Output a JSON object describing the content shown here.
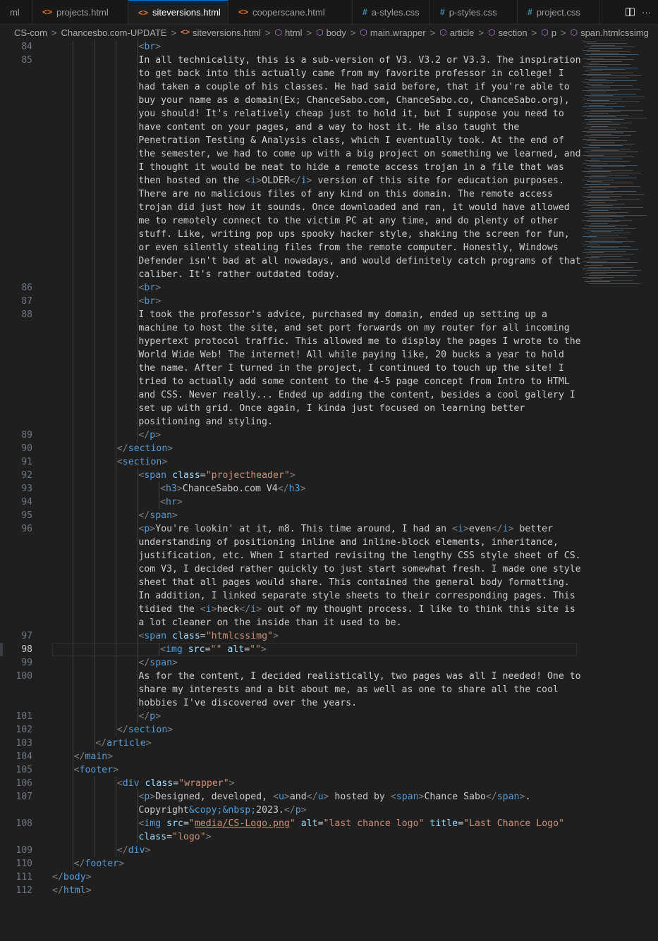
{
  "tabs": [
    {
      "label": "ml",
      "type": "none",
      "active": false
    },
    {
      "label": "projects.html",
      "type": "html",
      "active": false
    },
    {
      "label": "siteversions.html",
      "type": "html",
      "active": true,
      "modified": true
    },
    {
      "label": "cooperscane.html",
      "type": "html",
      "active": false
    },
    {
      "label": "a-styles.css",
      "type": "css",
      "active": false
    },
    {
      "label": "p-styles.css",
      "type": "css",
      "active": false
    },
    {
      "label": "project.css",
      "type": "css",
      "active": false
    }
  ],
  "icons": {
    "html_glyph": "<>",
    "css_glyph": "#",
    "more": "···",
    "sep": ">"
  },
  "breadcrumb": [
    {
      "label": "CS-com",
      "icon": ""
    },
    {
      "label": "Chancesbo.com-UPDATE",
      "icon": ""
    },
    {
      "label": "siteversions.html",
      "icon": "html"
    },
    {
      "label": "html",
      "icon": "cube"
    },
    {
      "label": "body",
      "icon": "cube"
    },
    {
      "label": "main.wrapper",
      "icon": "cube"
    },
    {
      "label": "article",
      "icon": "cube"
    },
    {
      "label": "section",
      "icon": "cube"
    },
    {
      "label": "p",
      "icon": "cube"
    },
    {
      "label": "span.htmlcssimg",
      "icon": "cube"
    }
  ],
  "current_line": 98,
  "colors": {
    "tag": "#569cd6",
    "attr": "#9cdcfe",
    "value": "#ce9178",
    "bracket": "#808080",
    "text": "#cccccc"
  },
  "lines": [
    {
      "n": "84",
      "i": 4,
      "tokens": [
        [
          "tg",
          "<"
        ],
        [
          "tn",
          "br"
        ],
        [
          "tg",
          ">"
        ]
      ]
    },
    {
      "n": "85",
      "i": 4,
      "tokens": [
        [
          "tx",
          "In all technicality, this is a sub-version of V3. V3.2 or V3.3. The inspiration"
        ]
      ]
    },
    {
      "n": "",
      "i": 4,
      "tokens": [
        [
          "tx",
          "to get back into this actually came from my favorite professor in college! I"
        ]
      ]
    },
    {
      "n": "",
      "i": 4,
      "tokens": [
        [
          "tx",
          "had taken a couple of his classes. He had said before, that if you're able to"
        ]
      ]
    },
    {
      "n": "",
      "i": 4,
      "tokens": [
        [
          "tx",
          "buy your name as a domain(Ex; ChanceSabo.com, ChanceSabo.co, ChanceSabo.org),"
        ]
      ]
    },
    {
      "n": "",
      "i": 4,
      "tokens": [
        [
          "tx",
          "you should! It's relatively cheap just to hold it, but I suppose you need to"
        ]
      ]
    },
    {
      "n": "",
      "i": 4,
      "tokens": [
        [
          "tx",
          "have content on your pages, and a way to host it. He also taught the"
        ]
      ]
    },
    {
      "n": "",
      "i": 4,
      "tokens": [
        [
          "tx",
          "Penetration Testing & Analysis class, which I eventually took. At the end of"
        ]
      ]
    },
    {
      "n": "",
      "i": 4,
      "tokens": [
        [
          "tx",
          "the semester, we had to come up with a big project on something we learned, and"
        ]
      ]
    },
    {
      "n": "",
      "i": 4,
      "tokens": [
        [
          "tx",
          "I thought it would be neat to hide a remote access trojan in a file that was"
        ]
      ]
    },
    {
      "n": "",
      "i": 4,
      "tokens": [
        [
          "tx",
          "then hosted on the "
        ],
        [
          "tg",
          "<"
        ],
        [
          "tn",
          "i"
        ],
        [
          "tg",
          ">"
        ],
        [
          "tx",
          "OLDER"
        ],
        [
          "tg",
          "</"
        ],
        [
          "tn",
          "i"
        ],
        [
          "tg",
          ">"
        ],
        [
          "tx",
          " version of this site for education purposes."
        ]
      ]
    },
    {
      "n": "",
      "i": 4,
      "tokens": [
        [
          "tx",
          "There are no malicious files of any kind on this domain. The remote access"
        ]
      ]
    },
    {
      "n": "",
      "i": 4,
      "tokens": [
        [
          "tx",
          "trojan did just how it sounds. Once downloaded and ran, it would have allowed"
        ]
      ]
    },
    {
      "n": "",
      "i": 4,
      "tokens": [
        [
          "tx",
          "me to remotely connect to the victim PC at any time, and do plenty of other"
        ]
      ]
    },
    {
      "n": "",
      "i": 4,
      "tokens": [
        [
          "tx",
          "stuff. Like, writing pop ups spooky hacker style, shaking the screen for fun,"
        ]
      ]
    },
    {
      "n": "",
      "i": 4,
      "tokens": [
        [
          "tx",
          "or even silently stealing files from the remote computer. Honestly, Windows"
        ]
      ]
    },
    {
      "n": "",
      "i": 4,
      "tokens": [
        [
          "tx",
          "Defender isn't bad at all nowadays, and would definitely catch programs of that"
        ]
      ]
    },
    {
      "n": "",
      "i": 4,
      "tokens": [
        [
          "tx",
          "caliber. It's rather outdated today."
        ]
      ]
    },
    {
      "n": "86",
      "i": 4,
      "tokens": [
        [
          "tg",
          "<"
        ],
        [
          "tn",
          "br"
        ],
        [
          "tg",
          ">"
        ]
      ]
    },
    {
      "n": "87",
      "i": 4,
      "tokens": [
        [
          "tg",
          "<"
        ],
        [
          "tn",
          "br"
        ],
        [
          "tg",
          ">"
        ]
      ]
    },
    {
      "n": "88",
      "i": 4,
      "tokens": [
        [
          "tx",
          "I took the professor's advice, purchased my domain, ended up setting up a"
        ]
      ]
    },
    {
      "n": "",
      "i": 4,
      "tokens": [
        [
          "tx",
          "machine to host the site, and set port forwards on my router for all incoming"
        ]
      ]
    },
    {
      "n": "",
      "i": 4,
      "tokens": [
        [
          "tx",
          "hypertext protocol traffic. This allowed me to display the pages I wrote to the"
        ]
      ]
    },
    {
      "n": "",
      "i": 4,
      "tokens": [
        [
          "tx",
          "World Wide Web! The internet! All while paying like, 20 bucks a year to hold"
        ]
      ]
    },
    {
      "n": "",
      "i": 4,
      "tokens": [
        [
          "tx",
          "the name. After I turned in the project, I continued to touch up the site! I"
        ]
      ]
    },
    {
      "n": "",
      "i": 4,
      "tokens": [
        [
          "tx",
          "tried to actually add some content to the 4-5 page concept from Intro to HTML"
        ]
      ]
    },
    {
      "n": "",
      "i": 4,
      "tokens": [
        [
          "tx",
          "and CSS. Never really... Ended up adding the content, besides a cool gallery I"
        ]
      ]
    },
    {
      "n": "",
      "i": 4,
      "tokens": [
        [
          "tx",
          "set up with grid. Once again, I kinda just focused on learning better"
        ]
      ]
    },
    {
      "n": "",
      "i": 4,
      "tokens": [
        [
          "tx",
          "positioning and styling."
        ]
      ]
    },
    {
      "n": "89",
      "i": 4,
      "tokens": [
        [
          "tg",
          "</"
        ],
        [
          "tn",
          "p"
        ],
        [
          "tg",
          ">"
        ]
      ]
    },
    {
      "n": "90",
      "i": 3,
      "tokens": [
        [
          "tg",
          "</"
        ],
        [
          "tn",
          "section"
        ],
        [
          "tg",
          ">"
        ]
      ]
    },
    {
      "n": "91",
      "i": 3,
      "tokens": [
        [
          "tg",
          "<"
        ],
        [
          "tn",
          "section"
        ],
        [
          "tg",
          ">"
        ]
      ]
    },
    {
      "n": "92",
      "i": 4,
      "tokens": [
        [
          "tg",
          "<"
        ],
        [
          "tn",
          "span"
        ],
        [
          "tx",
          " "
        ],
        [
          "at",
          "class"
        ],
        [
          "tx",
          "="
        ],
        [
          "av",
          "\"projectheader\""
        ],
        [
          "tg",
          ">"
        ]
      ]
    },
    {
      "n": "93",
      "i": 5,
      "tokens": [
        [
          "tg",
          "<"
        ],
        [
          "tn",
          "h3"
        ],
        [
          "tg",
          ">"
        ],
        [
          "tx",
          "ChanceSabo.com V4"
        ],
        [
          "tg",
          "</"
        ],
        [
          "tn",
          "h3"
        ],
        [
          "tg",
          ">"
        ]
      ]
    },
    {
      "n": "94",
      "i": 5,
      "tokens": [
        [
          "tg",
          "<"
        ],
        [
          "tn",
          "hr"
        ],
        [
          "tg",
          ">"
        ]
      ]
    },
    {
      "n": "95",
      "i": 4,
      "tokens": [
        [
          "tg",
          "</"
        ],
        [
          "tn",
          "span"
        ],
        [
          "tg",
          ">"
        ]
      ]
    },
    {
      "n": "96",
      "i": 4,
      "tokens": [
        [
          "tg",
          "<"
        ],
        [
          "tn",
          "p"
        ],
        [
          "tg",
          ">"
        ],
        [
          "tx",
          "You're lookin' at it, m8. This time around, I had an "
        ],
        [
          "tg",
          "<"
        ],
        [
          "tn",
          "i"
        ],
        [
          "tg",
          ">"
        ],
        [
          "tx",
          "even"
        ],
        [
          "tg",
          "</"
        ],
        [
          "tn",
          "i"
        ],
        [
          "tg",
          ">"
        ],
        [
          "tx",
          " better"
        ]
      ]
    },
    {
      "n": "",
      "i": 4,
      "tokens": [
        [
          "tx",
          "understanding of positioning inline and inline-block elements, inheritance,"
        ]
      ]
    },
    {
      "n": "",
      "i": 4,
      "tokens": [
        [
          "tx",
          "justification, etc. When I started revisitng the lengthy CSS style sheet of CS."
        ]
      ]
    },
    {
      "n": "",
      "i": 4,
      "tokens": [
        [
          "tx",
          "com V3, I decided rather quickly to just start somewhat fresh. I made one style"
        ]
      ]
    },
    {
      "n": "",
      "i": 4,
      "tokens": [
        [
          "tx",
          "sheet that all pages would share. This contained the general body formatting."
        ]
      ]
    },
    {
      "n": "",
      "i": 4,
      "tokens": [
        [
          "tx",
          "In addition, I linked separate style sheets to their corresponding pages. This"
        ]
      ]
    },
    {
      "n": "",
      "i": 4,
      "tokens": [
        [
          "tx",
          "tidied the "
        ],
        [
          "tg",
          "<"
        ],
        [
          "tn",
          "i"
        ],
        [
          "tg",
          ">"
        ],
        [
          "tx",
          "heck"
        ],
        [
          "tg",
          "</"
        ],
        [
          "tn",
          "i"
        ],
        [
          "tg",
          ">"
        ],
        [
          "tx",
          " out of my thought process. I like to think this site is"
        ]
      ]
    },
    {
      "n": "",
      "i": 4,
      "tokens": [
        [
          "tx",
          "a lot cleaner on the inside than it used to be."
        ]
      ]
    },
    {
      "n": "97",
      "i": 4,
      "tokens": [
        [
          "tg",
          "<"
        ],
        [
          "tn",
          "span"
        ],
        [
          "tx",
          " "
        ],
        [
          "at",
          "class"
        ],
        [
          "tx",
          "="
        ],
        [
          "av",
          "\"htmlcssimg\""
        ],
        [
          "tg",
          ">"
        ]
      ]
    },
    {
      "n": "98",
      "i": 5,
      "tokens": [
        [
          "tg",
          "<"
        ],
        [
          "tn",
          "img"
        ],
        [
          "tx",
          " "
        ],
        [
          "at",
          "src"
        ],
        [
          "tx",
          "="
        ],
        [
          "av",
          "\"\""
        ],
        [
          "tx",
          " "
        ],
        [
          "at",
          "alt"
        ],
        [
          "tx",
          "="
        ],
        [
          "av",
          "\"\""
        ],
        [
          "tg",
          ">"
        ]
      ]
    },
    {
      "n": "99",
      "i": 4,
      "tokens": [
        [
          "tg",
          "</"
        ],
        [
          "tn",
          "span"
        ],
        [
          "tg",
          ">"
        ]
      ]
    },
    {
      "n": "100",
      "i": 4,
      "tokens": [
        [
          "tx",
          "As for the content, I decided realistically, two pages was all I needed! One to"
        ]
      ]
    },
    {
      "n": "",
      "i": 4,
      "tokens": [
        [
          "tx",
          "share my interests and a bit about me, as well as one to share all the cool"
        ]
      ]
    },
    {
      "n": "",
      "i": 4,
      "tokens": [
        [
          "tx",
          "hobbies I've discovered over the years."
        ]
      ]
    },
    {
      "n": "101",
      "i": 4,
      "tokens": [
        [
          "tg",
          "</"
        ],
        [
          "tn",
          "p"
        ],
        [
          "tg",
          ">"
        ]
      ]
    },
    {
      "n": "102",
      "i": 3,
      "tokens": [
        [
          "tg",
          "</"
        ],
        [
          "tn",
          "section"
        ],
        [
          "tg",
          ">"
        ]
      ]
    },
    {
      "n": "103",
      "i": 2,
      "tokens": [
        [
          "tg",
          "</"
        ],
        [
          "tn",
          "article"
        ],
        [
          "tg",
          ">"
        ]
      ]
    },
    {
      "n": "104",
      "i": 1,
      "tokens": [
        [
          "tg",
          "</"
        ],
        [
          "tn",
          "main"
        ],
        [
          "tg",
          ">"
        ]
      ]
    },
    {
      "n": "105",
      "i": 1,
      "tokens": [
        [
          "tg",
          "<"
        ],
        [
          "tn",
          "footer"
        ],
        [
          "tg",
          ">"
        ]
      ]
    },
    {
      "n": "106",
      "i": 3,
      "tokens": [
        [
          "tg",
          "<"
        ],
        [
          "tn",
          "div"
        ],
        [
          "tx",
          " "
        ],
        [
          "at",
          "class"
        ],
        [
          "tx",
          "="
        ],
        [
          "av",
          "\"wrapper\""
        ],
        [
          "tg",
          ">"
        ]
      ]
    },
    {
      "n": "107",
      "i": 4,
      "tokens": [
        [
          "tg",
          "<"
        ],
        [
          "tn",
          "p"
        ],
        [
          "tg",
          ">"
        ],
        [
          "tx",
          "Designed, developed, "
        ],
        [
          "tg",
          "<"
        ],
        [
          "tn",
          "u"
        ],
        [
          "tg",
          ">"
        ],
        [
          "tx",
          "and"
        ],
        [
          "tg",
          "</"
        ],
        [
          "tn",
          "u"
        ],
        [
          "tg",
          ">"
        ],
        [
          "tx",
          " hosted by "
        ],
        [
          "tg",
          "<"
        ],
        [
          "tn",
          "span"
        ],
        [
          "tg",
          ">"
        ],
        [
          "tx",
          "Chance Sabo"
        ],
        [
          "tg",
          "</"
        ],
        [
          "tn",
          "span"
        ],
        [
          "tg",
          ">"
        ],
        [
          "tx",
          "."
        ]
      ]
    },
    {
      "n": "",
      "i": 4,
      "tokens": [
        [
          "tx",
          "Copyright"
        ],
        [
          "ent",
          "&copy;&nbsp;"
        ],
        [
          "tx",
          "2023."
        ],
        [
          "tg",
          "</"
        ],
        [
          "tn",
          "p"
        ],
        [
          "tg",
          ">"
        ]
      ]
    },
    {
      "n": "108",
      "i": 4,
      "tokens": [
        [
          "tg",
          "<"
        ],
        [
          "tn",
          "img"
        ],
        [
          "tx",
          " "
        ],
        [
          "at",
          "src"
        ],
        [
          "tx",
          "="
        ],
        [
          "av",
          "\""
        ],
        [
          "av u",
          "media/CS-Logo.png"
        ],
        [
          "av",
          "\""
        ],
        [
          "tx",
          " "
        ],
        [
          "at",
          "alt"
        ],
        [
          "tx",
          "="
        ],
        [
          "av",
          "\"last chance logo\""
        ],
        [
          "tx",
          " "
        ],
        [
          "at",
          "title"
        ],
        [
          "tx",
          "="
        ],
        [
          "av",
          "\"Last Chance Logo\""
        ]
      ]
    },
    {
      "n": "",
      "i": 4,
      "tokens": [
        [
          "at",
          "class"
        ],
        [
          "tx",
          "="
        ],
        [
          "av",
          "\"logo\""
        ],
        [
          "tg",
          ">"
        ]
      ]
    },
    {
      "n": "109",
      "i": 3,
      "tokens": [
        [
          "tg",
          "</"
        ],
        [
          "tn",
          "div"
        ],
        [
          "tg",
          ">"
        ]
      ]
    },
    {
      "n": "110",
      "i": 1,
      "tokens": [
        [
          "tg",
          "</"
        ],
        [
          "tn",
          "footer"
        ],
        [
          "tg",
          ">"
        ]
      ]
    },
    {
      "n": "111",
      "i": 0,
      "tokens": [
        [
          "tg",
          "</"
        ],
        [
          "tn",
          "body"
        ],
        [
          "tg",
          ">"
        ]
      ]
    },
    {
      "n": "112",
      "i": 0,
      "tokens": [
        [
          "tg",
          "</"
        ],
        [
          "tn",
          "html"
        ],
        [
          "tg",
          ">"
        ]
      ]
    }
  ]
}
